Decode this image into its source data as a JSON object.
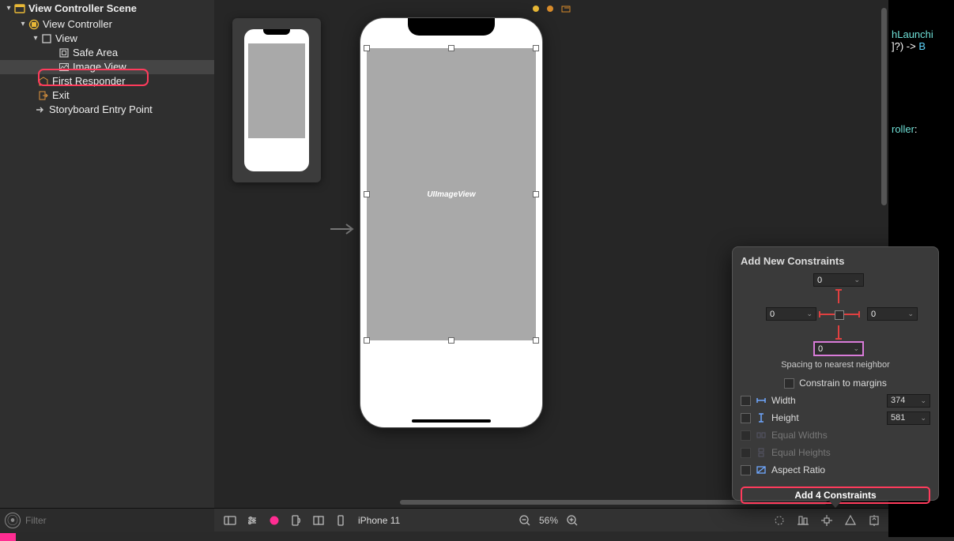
{
  "outline": {
    "root": "View Controller Scene",
    "items": [
      {
        "label": "View Controller",
        "indent": 24,
        "disclosure": "▾",
        "icon": "vc"
      },
      {
        "label": "View",
        "indent": 40,
        "disclosure": "▾",
        "icon": "view"
      },
      {
        "label": "Safe Area",
        "indent": 62,
        "disclosure": "",
        "icon": "safearea"
      },
      {
        "label": "Image View",
        "indent": 62,
        "disclosure": "",
        "icon": "imageview",
        "selected": true
      },
      {
        "label": "First Responder",
        "indent": 40,
        "disclosure": "",
        "icon": "firstresponder"
      },
      {
        "label": "Exit",
        "indent": 40,
        "disclosure": "",
        "icon": "exit"
      },
      {
        "label": "Storyboard Entry Point",
        "indent": 40,
        "disclosure": "",
        "icon": "entry"
      }
    ]
  },
  "filter": {
    "placeholder": "Filter"
  },
  "canvas": {
    "thumb_label": "",
    "imageview_label": "UIImageView"
  },
  "bottombar": {
    "device": "iPhone 11",
    "zoom": "56%"
  },
  "code": {
    "l1a": "hLaunchi",
    "l2a": "]?) -> ",
    "l2b": "B",
    "l3a": "roller",
    "l3b": ":"
  },
  "popover": {
    "title": "Add New Constraints",
    "top": "0",
    "left": "0",
    "right": "0",
    "bottom": "0",
    "spacing_label": "Spacing to nearest neighbor",
    "constrain_margins": "Constrain to margins",
    "width_label": "Width",
    "width_value": "374",
    "height_label": "Height",
    "height_value": "581",
    "equal_widths": "Equal Widths",
    "equal_heights": "Equal Heights",
    "aspect_ratio": "Aspect Ratio",
    "add_button": "Add 4 Constraints"
  }
}
